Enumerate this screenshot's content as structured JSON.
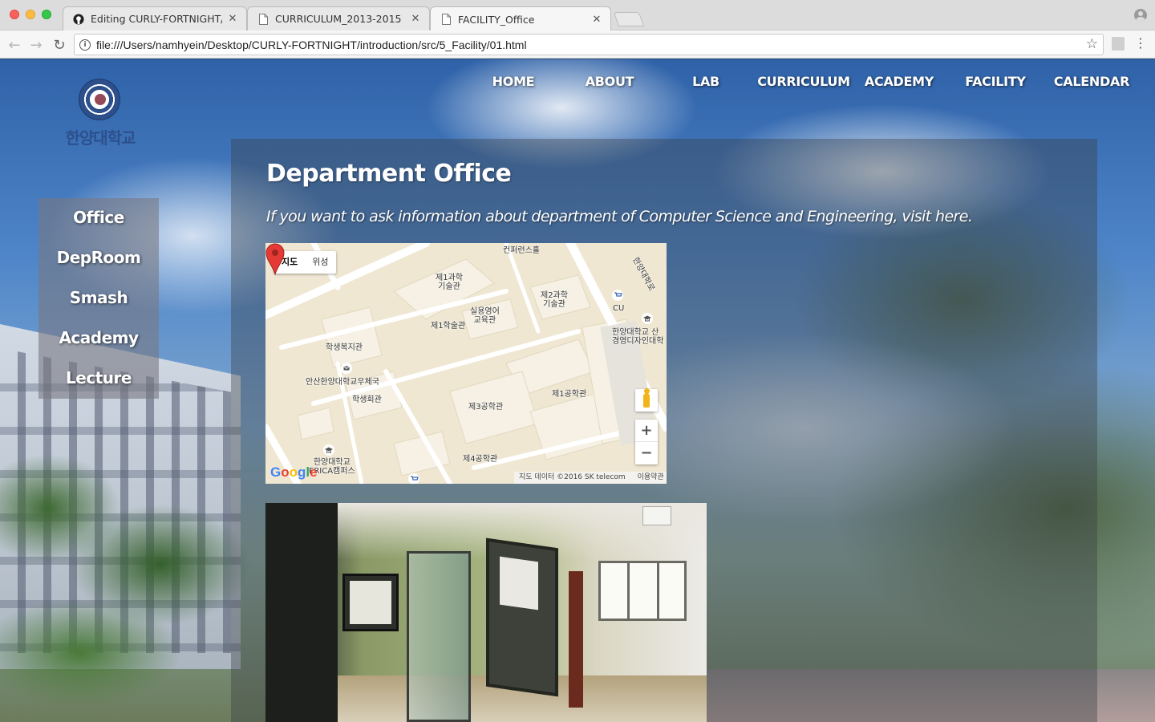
{
  "browser": {
    "tabs": [
      {
        "title": "Editing CURLY-FORTNIGHT/RE",
        "icon": "github-icon",
        "active": false
      },
      {
        "title": "CURRICULUM_2013-2015",
        "icon": "document-icon",
        "active": false
      },
      {
        "title": "FACILITY_Office",
        "icon": "document-icon",
        "active": true
      }
    ],
    "url": "file:///Users/namhyein/Desktop/CURLY-FORTNIGHT/introduction/src/5_Facility/01.html"
  },
  "site": {
    "logo_text": "한양대학교",
    "nav": [
      "HOME",
      "ABOUT",
      "LAB",
      "CURRICULUM",
      "ACADEMY",
      "FACILITY",
      "CALENDAR"
    ],
    "side_menu": [
      "Office",
      "DepRoom",
      "Smash",
      "Academy",
      "Lecture"
    ]
  },
  "main": {
    "heading": "Department Office",
    "subtext": "If you want to ask information about department of Computer Science and Engineering, visit here."
  },
  "map": {
    "type_buttons": [
      "지도",
      "위성"
    ],
    "selected_type": "지도",
    "labels": [
      "컨퍼런스홀",
      "제1과학\n기술관",
      "제2과학\n기술관",
      "실용영어\n교육관",
      "제1학술관",
      "CU",
      "한양대학교 산\n경영디자인대학",
      "학생복지관",
      "안산한양대학교우체국",
      "학생회관",
      "제3공학관",
      "제1공학관",
      "한양대학교\nERICA캠퍼스",
      "제4공학관",
      "한양대학로"
    ],
    "zoom_in": "+",
    "zoom_out": "−",
    "google_letters": [
      "G",
      "o",
      "o",
      "g",
      "l",
      "e"
    ],
    "attribution": "지도 데이터 ©2016 SK telecom",
    "terms": "이용약관"
  },
  "colors": {
    "nav_text": "#ffffff",
    "map_bg": "#efe7d2",
    "map_road": "#ffffff",
    "pin": "#e53935"
  }
}
